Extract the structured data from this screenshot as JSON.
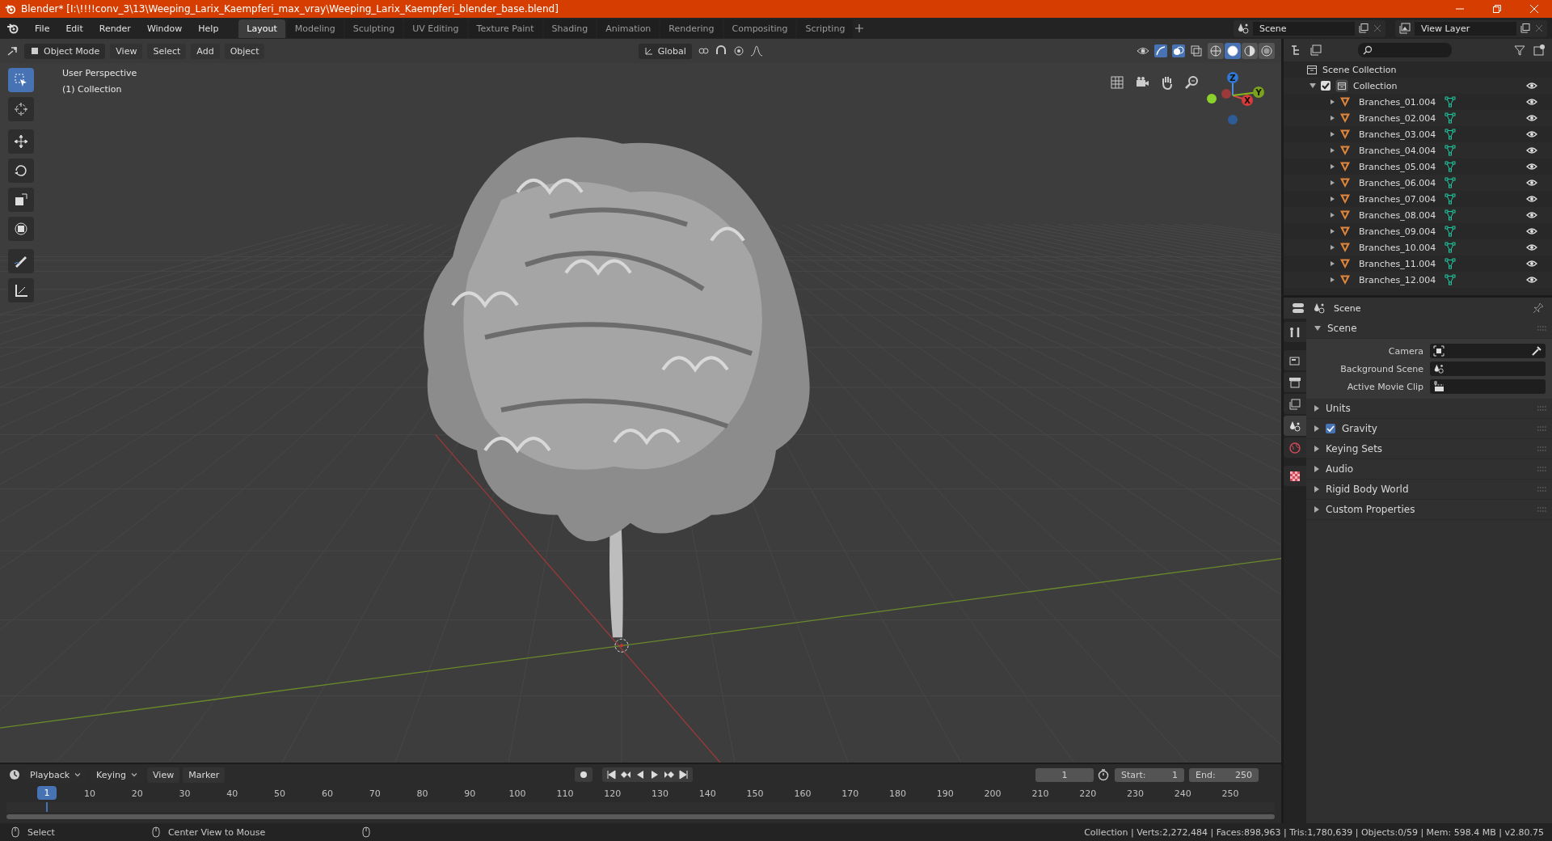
{
  "title_bar": {
    "title": "Blender* [I:\\!!!!conv_3\\13\\Weeping_Larix_Kaempferi_max_vray\\Weeping_Larix_Kaempferi_blender_base.blend]"
  },
  "menu": [
    "File",
    "Edit",
    "Render",
    "Window",
    "Help"
  ],
  "workspaces": [
    {
      "label": "Layout",
      "selected": true
    },
    {
      "label": "Modeling",
      "selected": false
    },
    {
      "label": "Sculpting",
      "selected": false
    },
    {
      "label": "UV Editing",
      "selected": false
    },
    {
      "label": "Texture Paint",
      "selected": false
    },
    {
      "label": "Shading",
      "selected": false
    },
    {
      "label": "Animation",
      "selected": false
    },
    {
      "label": "Rendering",
      "selected": false
    },
    {
      "label": "Compositing",
      "selected": false
    },
    {
      "label": "Scripting",
      "selected": false
    }
  ],
  "scene_selector": {
    "value": "Scene"
  },
  "view_layer_selector": {
    "value": "View Layer"
  },
  "viewport_header": {
    "mode": "Object Mode",
    "menus": [
      "View",
      "Select",
      "Add",
      "Object"
    ],
    "orientation": "Global",
    "shading": [
      {
        "kind": "wireframe",
        "selected": false
      },
      {
        "kind": "solid",
        "selected": true
      },
      {
        "kind": "material",
        "selected": false
      },
      {
        "kind": "rendered",
        "selected": false
      }
    ]
  },
  "viewport": {
    "perspective": "User Perspective",
    "collection": "(1) Collection",
    "tools": [
      {
        "kind": "select",
        "selected": true
      },
      {
        "kind": "cursor",
        "selected": false
      },
      {
        "kind": "move",
        "selected": false
      },
      {
        "kind": "rotate",
        "selected": false
      },
      {
        "kind": "scale",
        "selected": false
      },
      {
        "kind": "transform",
        "selected": false
      },
      {
        "kind": "annotate",
        "selected": false
      },
      {
        "kind": "measure",
        "selected": false
      }
    ],
    "gizmo_axes": [
      "Z",
      "X",
      "Y"
    ]
  },
  "outliner": {
    "root": "Scene Collection",
    "collections": [
      {
        "name": "Collection",
        "expanded": true,
        "checked": true,
        "children": [
          {
            "name": "Branches_01.004"
          },
          {
            "name": "Branches_02.004"
          },
          {
            "name": "Branches_03.004"
          },
          {
            "name": "Branches_04.004"
          },
          {
            "name": "Branches_05.004"
          },
          {
            "name": "Branches_06.004"
          },
          {
            "name": "Branches_07.004"
          },
          {
            "name": "Branches_08.004"
          },
          {
            "name": "Branches_09.004"
          },
          {
            "name": "Branches_10.004"
          },
          {
            "name": "Branches_11.004"
          },
          {
            "name": "Branches_12.004"
          }
        ]
      }
    ]
  },
  "properties": {
    "context": "Scene",
    "tabs": [
      {
        "kind": "tool",
        "selected": false
      },
      {
        "kind": "render",
        "selected": false
      },
      {
        "kind": "output",
        "selected": false
      },
      {
        "kind": "view_layer",
        "selected": false
      },
      {
        "kind": "scene",
        "selected": true
      },
      {
        "kind": "world",
        "selected": false
      },
      {
        "kind": "texture",
        "selected": false
      }
    ],
    "panels": [
      {
        "title": "Scene",
        "expanded": true,
        "fields": [
          {
            "label": "Camera",
            "kind": "camera"
          },
          {
            "label": "Background Scene",
            "kind": "scene"
          },
          {
            "label": "Active Movie Clip",
            "kind": "clip"
          }
        ]
      },
      {
        "title": "Units",
        "expanded": false
      },
      {
        "title": "Gravity",
        "expanded": false,
        "checked": true
      },
      {
        "title": "Keying Sets",
        "expanded": false
      },
      {
        "title": "Audio",
        "expanded": false
      },
      {
        "title": "Rigid Body World",
        "expanded": false
      },
      {
        "title": "Custom Properties",
        "expanded": false
      }
    ]
  },
  "timeline": {
    "menus": [
      "Playback",
      "Keying",
      "View",
      "Marker"
    ],
    "current_frame": "1",
    "start_label": "Start:",
    "start": "1",
    "end_label": "End:",
    "end": "250",
    "playhead": "1",
    "ticks": [
      "10",
      "20",
      "30",
      "40",
      "50",
      "60",
      "70",
      "80",
      "90",
      "100",
      "110",
      "120",
      "130",
      "140",
      "150",
      "160",
      "170",
      "180",
      "190",
      "200",
      "210",
      "220",
      "230",
      "240",
      "250"
    ]
  },
  "status_bar": {
    "hints": [
      "Select",
      "Center View to Mouse"
    ],
    "stats": "Collection | Verts:2,272,484 | Faces:898,963 | Tris:1,780,639 | Objects:0/59 | Mem: 598.4 MB | v2.80.75"
  }
}
